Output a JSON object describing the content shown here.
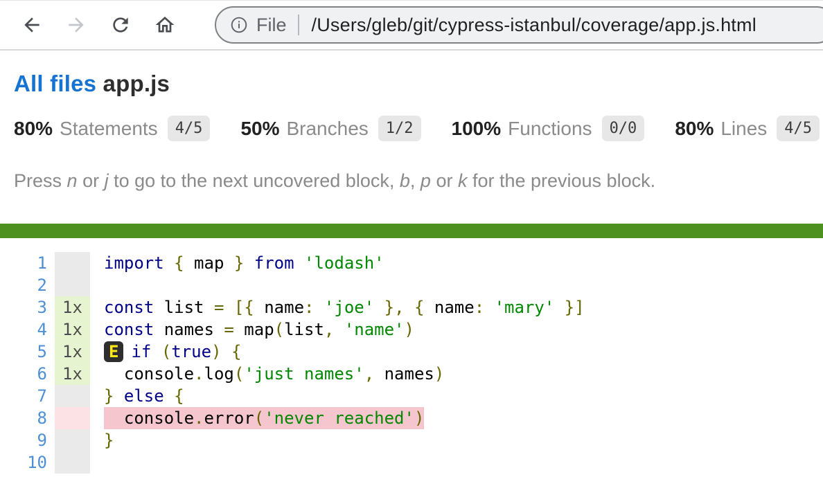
{
  "browser": {
    "scheme_label": "File",
    "url_path": "/Users/gleb/git/cypress-istanbul/coverage/app.js.html"
  },
  "header": {
    "breadcrumb_link": "All files",
    "file_name": "app.js"
  },
  "stats": [
    {
      "pct": "80%",
      "label": "Statements",
      "fraction": "4/5"
    },
    {
      "pct": "50%",
      "label": "Branches",
      "fraction": "1/2"
    },
    {
      "pct": "100%",
      "label": "Functions",
      "fraction": "0/0"
    },
    {
      "pct": "80%",
      "label": "Lines",
      "fraction": "4/5"
    }
  ],
  "help_segments": [
    {
      "t": "Press "
    },
    {
      "t": "n",
      "i": true
    },
    {
      "t": " or "
    },
    {
      "t": "j",
      "i": true
    },
    {
      "t": " to go to the next uncovered block, "
    },
    {
      "t": "b",
      "i": true
    },
    {
      "t": ", "
    },
    {
      "t": "p",
      "i": true
    },
    {
      "t": " or "
    },
    {
      "t": "k",
      "i": true
    },
    {
      "t": " for the previous block."
    }
  ],
  "colors": {
    "link_blue": "#1673d2",
    "bar_green": "#4d9221",
    "covered_count_bg": "#e6f5d0",
    "uncovered_count_bg": "#fce1e5",
    "uncovered_code_bg": "#f6c6ce",
    "keyword": "#000088",
    "string": "#008800",
    "punctuation": "#666600",
    "line_number_blue": "#4d90d5"
  },
  "code": {
    "branch_marker": "E",
    "lines": [
      {
        "num": "1",
        "count": "",
        "status": "neutral",
        "tokens": [
          {
            "c": "kwd",
            "t": "import"
          },
          {
            "c": "pln",
            "t": " "
          },
          {
            "c": "pun",
            "t": "{"
          },
          {
            "c": "pln",
            "t": " map "
          },
          {
            "c": "pun",
            "t": "}"
          },
          {
            "c": "pln",
            "t": " "
          },
          {
            "c": "kwd",
            "t": "from"
          },
          {
            "c": "pln",
            "t": " "
          },
          {
            "c": "str",
            "t": "'lodash'"
          }
        ]
      },
      {
        "num": "2",
        "count": "",
        "status": "neutral",
        "tokens": []
      },
      {
        "num": "3",
        "count": "1x",
        "status": "covered",
        "tokens": [
          {
            "c": "kwd",
            "t": "const"
          },
          {
            "c": "pln",
            "t": " list "
          },
          {
            "c": "pun",
            "t": "="
          },
          {
            "c": "pln",
            "t": " "
          },
          {
            "c": "pun",
            "t": "[{"
          },
          {
            "c": "pln",
            "t": " name"
          },
          {
            "c": "pun",
            "t": ":"
          },
          {
            "c": "pln",
            "t": " "
          },
          {
            "c": "str",
            "t": "'joe'"
          },
          {
            "c": "pln",
            "t": " "
          },
          {
            "c": "pun",
            "t": "},"
          },
          {
            "c": "pln",
            "t": " "
          },
          {
            "c": "pun",
            "t": "{"
          },
          {
            "c": "pln",
            "t": " name"
          },
          {
            "c": "pun",
            "t": ":"
          },
          {
            "c": "pln",
            "t": " "
          },
          {
            "c": "str",
            "t": "'mary'"
          },
          {
            "c": "pln",
            "t": " "
          },
          {
            "c": "pun",
            "t": "}]"
          }
        ]
      },
      {
        "num": "4",
        "count": "1x",
        "status": "covered",
        "tokens": [
          {
            "c": "kwd",
            "t": "const"
          },
          {
            "c": "pln",
            "t": " names "
          },
          {
            "c": "pun",
            "t": "="
          },
          {
            "c": "pln",
            "t": " map"
          },
          {
            "c": "pun",
            "t": "("
          },
          {
            "c": "pln",
            "t": "list"
          },
          {
            "c": "pun",
            "t": ","
          },
          {
            "c": "pln",
            "t": " "
          },
          {
            "c": "str",
            "t": "'name'"
          },
          {
            "c": "pun",
            "t": ")"
          }
        ]
      },
      {
        "num": "5",
        "count": "1x",
        "status": "covered",
        "branch_marker": true,
        "tokens": [
          {
            "c": "kwd",
            "t": "if"
          },
          {
            "c": "pln",
            "t": " "
          },
          {
            "c": "pun",
            "t": "("
          },
          {
            "c": "kwd",
            "t": "true"
          },
          {
            "c": "pun",
            "t": ")"
          },
          {
            "c": "pln",
            "t": " "
          },
          {
            "c": "pun",
            "t": "{"
          }
        ]
      },
      {
        "num": "6",
        "count": "1x",
        "status": "covered",
        "tokens": [
          {
            "c": "pln",
            "t": "  console"
          },
          {
            "c": "pun",
            "t": "."
          },
          {
            "c": "pln",
            "t": "log"
          },
          {
            "c": "pun",
            "t": "("
          },
          {
            "c": "str",
            "t": "'just names'"
          },
          {
            "c": "pun",
            "t": ","
          },
          {
            "c": "pln",
            "t": " names"
          },
          {
            "c": "pun",
            "t": ")"
          }
        ]
      },
      {
        "num": "7",
        "count": "",
        "status": "neutral",
        "tokens": [
          {
            "c": "pun",
            "t": "}"
          },
          {
            "c": "pln",
            "t": " "
          },
          {
            "c": "kwd",
            "t": "else"
          },
          {
            "c": "pln",
            "t": " "
          },
          {
            "c": "pun",
            "t": "{"
          }
        ]
      },
      {
        "num": "8",
        "count": "",
        "status": "uncovered",
        "highlight": true,
        "tokens": [
          {
            "c": "pln",
            "t": "  console"
          },
          {
            "c": "pun",
            "t": "."
          },
          {
            "c": "pln",
            "t": "error"
          },
          {
            "c": "pun",
            "t": "("
          },
          {
            "c": "str",
            "t": "'never reached'"
          },
          {
            "c": "pun",
            "t": ")"
          }
        ]
      },
      {
        "num": "9",
        "count": "",
        "status": "neutral",
        "tokens": [
          {
            "c": "pun",
            "t": "}"
          }
        ]
      },
      {
        "num": "10",
        "count": "",
        "status": "neutral",
        "tokens": []
      }
    ]
  }
}
